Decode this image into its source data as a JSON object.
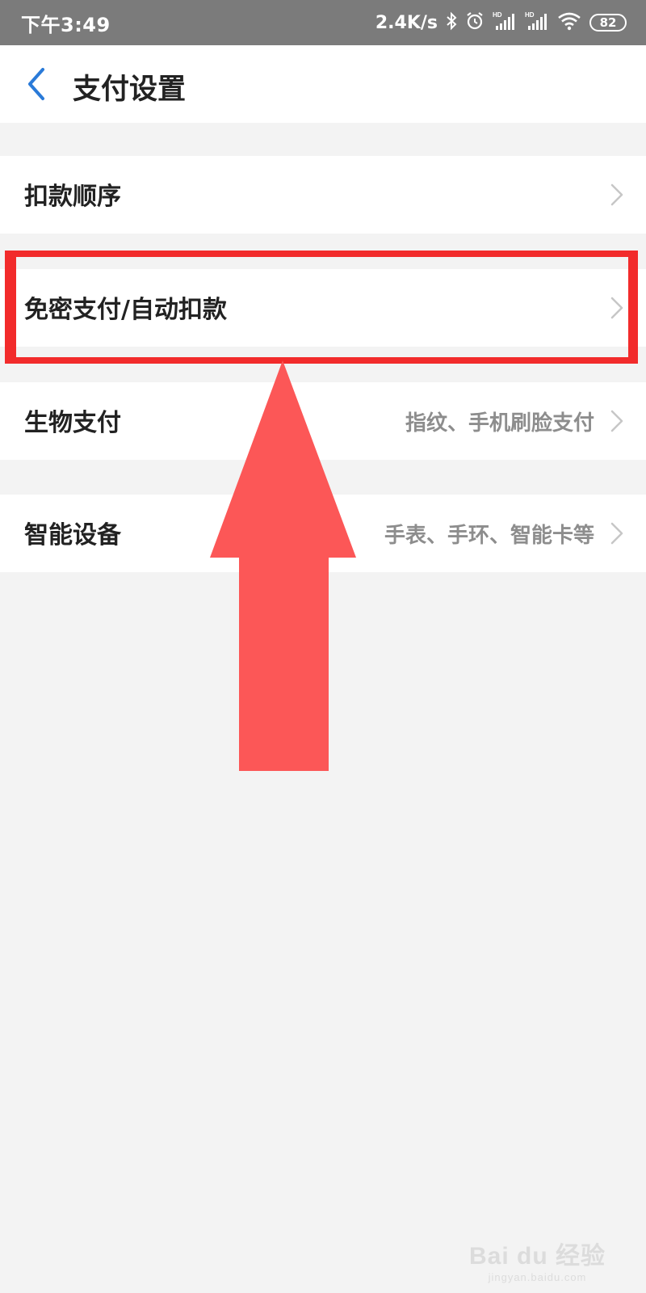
{
  "status_bar": {
    "time": "下午3:49",
    "net_speed": "2.4K/s",
    "battery": "82",
    "icons": [
      "bluetooth-icon",
      "alarm-icon",
      "hd-signal-icon",
      "hd-signal-icon",
      "wifi-icon",
      "battery-icon"
    ]
  },
  "header": {
    "title": "支付设置",
    "back_icon": "chevron-left-icon"
  },
  "settings": [
    {
      "label": "扣款顺序",
      "value": ""
    },
    {
      "label": "免密支付/自动扣款",
      "value": ""
    },
    {
      "label": "生物支付",
      "value": "指纹、手机刷脸支付"
    },
    {
      "label": "智能设备",
      "value": "手表、手环、智能卡等"
    }
  ],
  "annotation": {
    "highlight_color": "#f22b2b",
    "arrow_color": "#fc5757",
    "highlighted_item": "免密支付/自动扣款"
  },
  "watermark": {
    "logo": "Bai du 经验",
    "url": "jingyan.baidu.com"
  }
}
